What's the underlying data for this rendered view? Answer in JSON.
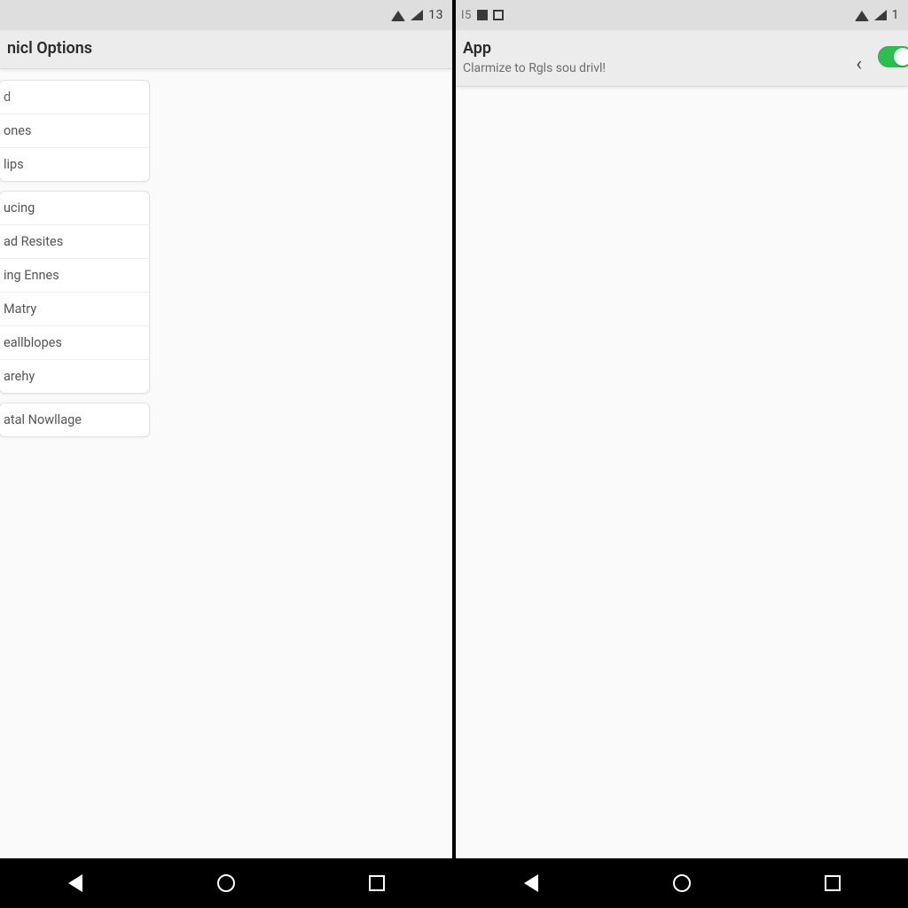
{
  "left": {
    "status": {
      "leftText": "",
      "clock": "13"
    },
    "header": {
      "title": "nicl Options"
    },
    "cards": [
      {
        "rows": [
          "d",
          "ones",
          "lips"
        ]
      },
      {
        "rows": [
          "ucing",
          "ad Resites",
          "ing Ennes",
          "Matry",
          "eallblopes",
          "arehy"
        ]
      },
      {
        "rows": [
          "atal Nowllage"
        ]
      }
    ]
  },
  "right": {
    "status": {
      "leftText": "I5",
      "clock": "1"
    },
    "header": {
      "title": "App",
      "subtitle": "Clarmize to Rgls sou drivl!"
    },
    "toggle": {
      "on": true
    }
  },
  "nav": {
    "backLabel": "Back",
    "homeLabel": "Home",
    "recentsLabel": "Recents"
  },
  "colors": {
    "accent": "#2bbf4e"
  }
}
